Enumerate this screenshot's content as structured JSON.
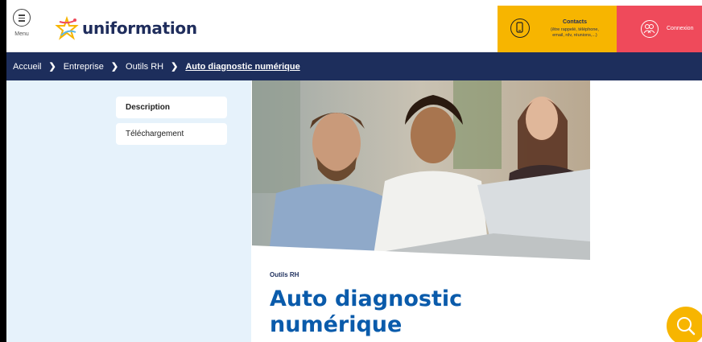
{
  "header": {
    "menu_label": "Menu",
    "logo_text": "uniformation",
    "contacts": {
      "title": "Contacts",
      "subtitle_line1": "(être rappelé, téléphone,",
      "subtitle_line2": "email, rdv, réunions,...)"
    },
    "connexion_label": "Connexion"
  },
  "breadcrumb": {
    "items": [
      "Accueil",
      "Entreprise",
      "Outils RH"
    ],
    "current": "Auto diagnostic numérique"
  },
  "sidebar": {
    "items": [
      {
        "label": "Description",
        "active": true
      },
      {
        "label": "Téléchargement",
        "active": false
      }
    ]
  },
  "content": {
    "kicker": "Outils RH",
    "title_line1": "Auto diagnostic",
    "title_line2": "numérique"
  },
  "icons": {
    "menu": "hamburger-menu-icon",
    "logo": "star-logo-icon",
    "contacts": "phone-icon",
    "connexion": "users-icon",
    "breadcrumb_separator": "chevron-right-icon",
    "search": "search-icon"
  },
  "colors": {
    "navy": "#1d2e5c",
    "yellow": "#f7b500",
    "red": "#ef4a5b",
    "blue_title": "#0a5bab",
    "sidebar_bg": "#e6f2fb"
  }
}
